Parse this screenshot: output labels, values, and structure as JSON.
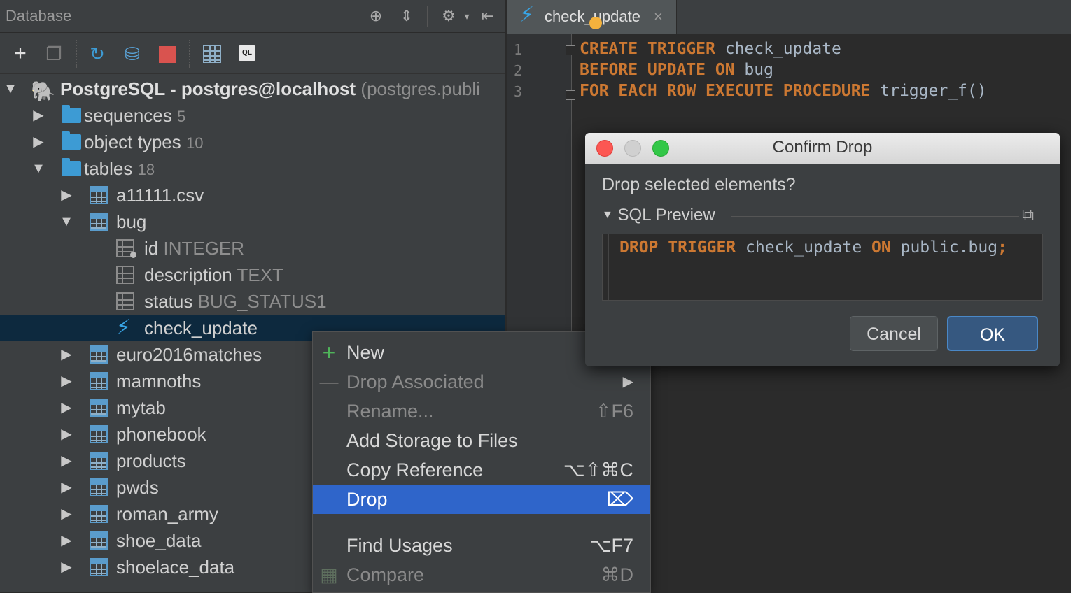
{
  "panel": {
    "title": "Database",
    "header_icons": [
      "crosshair-icon",
      "collapse-icon",
      "gear-icon",
      "hide-panel-icon"
    ],
    "toolbar_icons": [
      "add-icon",
      "copy-icon",
      "refresh-icon",
      "sync-icon",
      "stop-icon",
      "table-view-icon",
      "console-icon"
    ],
    "console_badge": "QL"
  },
  "tree": {
    "root_name": "PostgreSQL - postgres@localhost",
    "root_detail": "(postgres.publi",
    "sequences": {
      "label": "sequences",
      "count": "5"
    },
    "object_types": {
      "label": "object types",
      "count": "10"
    },
    "tables": {
      "label": "tables",
      "count": "18"
    },
    "items": {
      "a11111": "a11111.csv",
      "bug": "bug",
      "col_id": {
        "name": "id",
        "type": "INTEGER"
      },
      "col_description": {
        "name": "description",
        "type": "TEXT"
      },
      "col_status": {
        "name": "status",
        "type": "BUG_STATUS1"
      },
      "trigger": "check_update",
      "euro": "euro2016matches",
      "mamnoths": "mamnoths",
      "mytab": "mytab",
      "phonebook": "phonebook",
      "products": "products",
      "pwds": "pwds",
      "roman_army": "roman_army",
      "shoe_data": "shoe_data",
      "shoelace_data": "shoelace_data"
    }
  },
  "editor": {
    "tab_label": "check_update",
    "tab_close": "×",
    "line_numbers": [
      "1",
      "2",
      "3"
    ],
    "line1": {
      "kw": "CREATE TRIGGER",
      "rest": " check_update"
    },
    "line2": {
      "kw": "BEFORE UPDATE ON",
      "rest": " bug"
    },
    "line3": {
      "kw": "FOR EACH ROW EXECUTE PROCEDURE",
      "rest": " trigger_f()"
    }
  },
  "dialog": {
    "title": "Confirm Drop",
    "question": "Drop selected elements?",
    "sql_preview_label": "SQL Preview",
    "sql": {
      "kw1": "DROP TRIGGER",
      "name": " check_update ",
      "kw2": "ON",
      "target": " public.bug",
      "semi": ";"
    },
    "cancel_label": "Cancel",
    "ok_label": "OK"
  },
  "context_menu": {
    "new": "New",
    "drop_associated": "Drop Associated",
    "rename": "Rename...",
    "rename_sc": "⇧F6",
    "add_storage": "Add Storage to Files",
    "copy_reference": "Copy Reference",
    "copy_reference_sc": "⌥⇧⌘C",
    "drop": "Drop",
    "drop_sc": "⌦",
    "find_usages": "Find Usages",
    "find_usages_sc": "⌥F7",
    "compare": "Compare",
    "compare_sc": "⌘D"
  },
  "colors": {
    "selection": "#0d293e",
    "menu_active": "#2f65ca",
    "keyword": "#cc7832",
    "trigger_icon": "#38a5e6"
  }
}
